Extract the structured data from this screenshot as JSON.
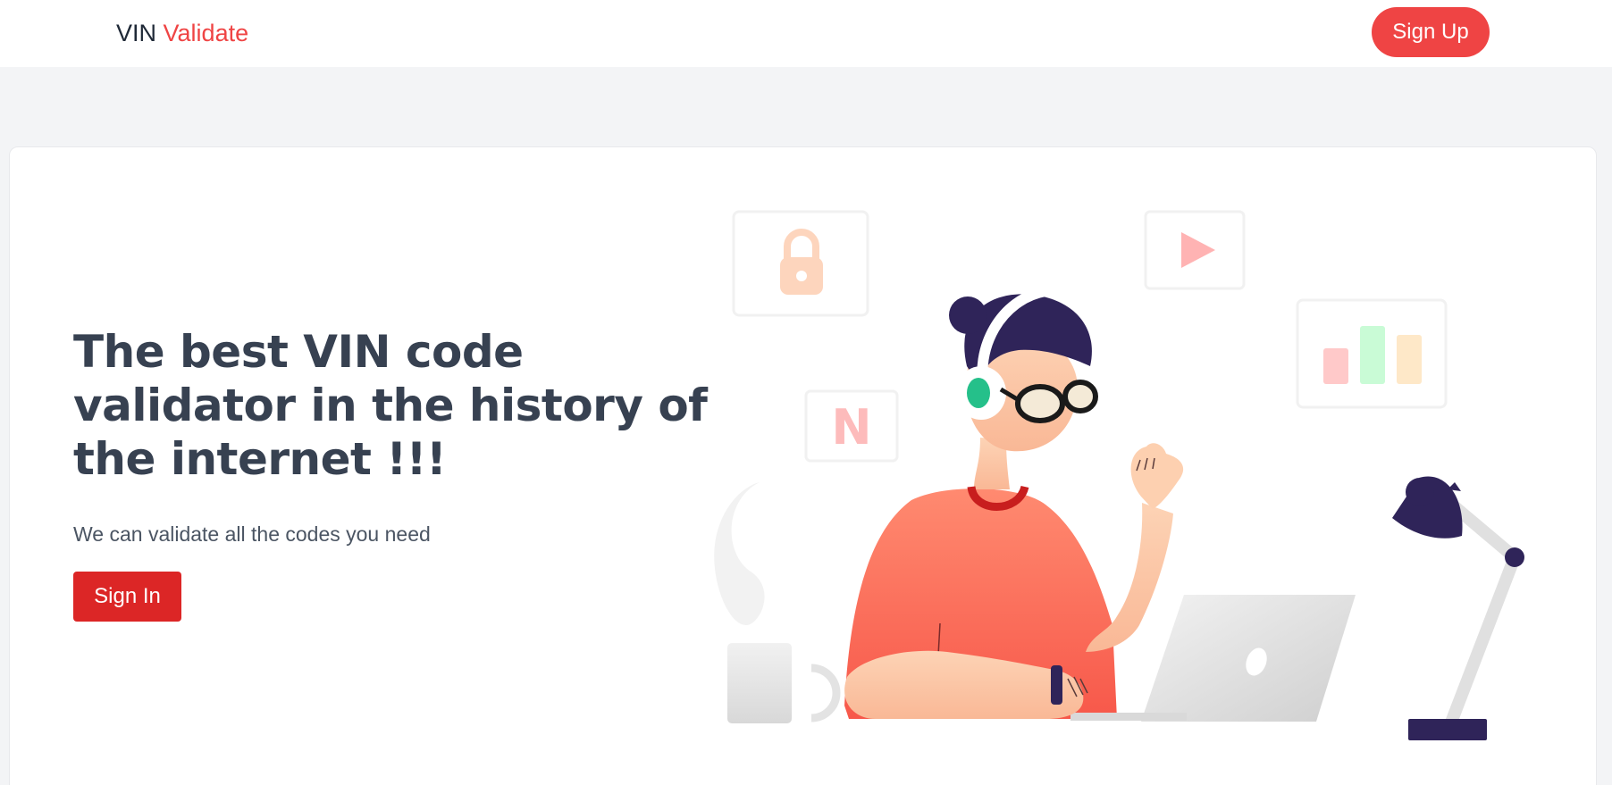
{
  "nav": {
    "brand_primary": "VIN",
    "brand_accent": "Validate",
    "signup_label": "Sign Up"
  },
  "hero": {
    "title": "The best VIN code validator in the history of the internet !!!",
    "subtitle": "We can validate all the codes you need",
    "signin_label": "Sign In"
  },
  "illustration": {
    "tile_letter": "N"
  },
  "colors": {
    "accent": "#ef4444",
    "signin": "#dc2626",
    "heading": "#374151",
    "page_bg": "#f3f4f6"
  }
}
